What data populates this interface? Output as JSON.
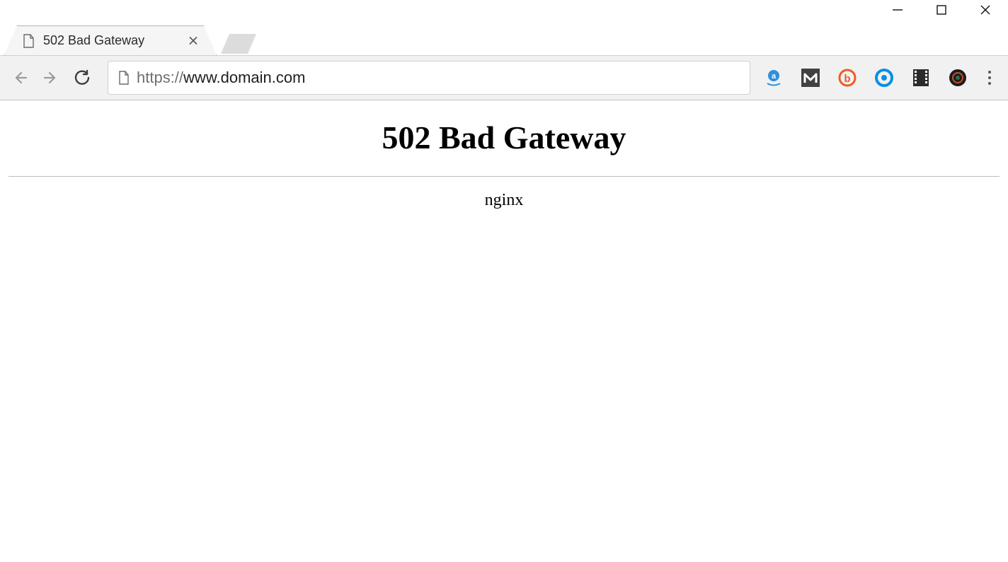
{
  "window": {
    "controls": {
      "min": "minimize",
      "max": "maximize",
      "close": "close"
    }
  },
  "tabs": {
    "active": {
      "title": "502 Bad Gateway"
    }
  },
  "toolbar": {
    "url_scheme": "https://",
    "url_host": "www.domain.com",
    "extensions": [
      {
        "name": "amazon-assistant-icon"
      },
      {
        "name": "mega-extension-icon"
      },
      {
        "name": "bitly-extension-icon"
      },
      {
        "name": "q-extension-icon"
      },
      {
        "name": "film-extension-icon"
      },
      {
        "name": "lens-extension-icon"
      }
    ]
  },
  "page": {
    "heading": "502 Bad Gateway",
    "server": "nginx"
  }
}
